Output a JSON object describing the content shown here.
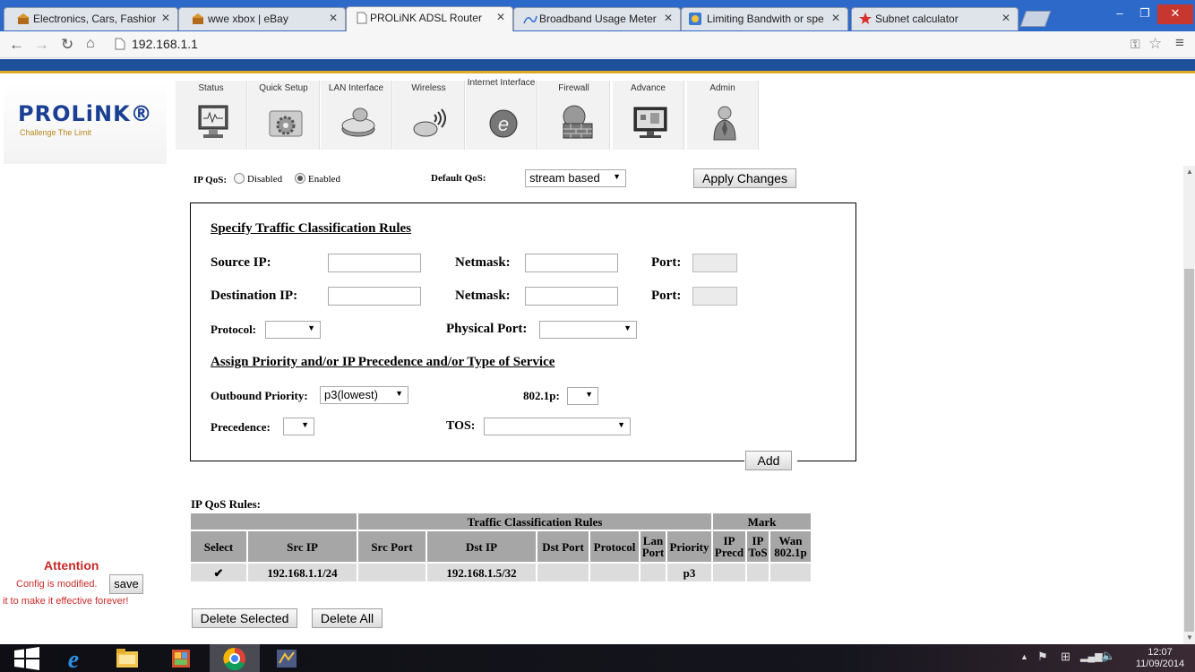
{
  "browser": {
    "tabs": [
      {
        "title": "Electronics, Cars, Fashion,",
        "active": false
      },
      {
        "title": "wwe xbox | eBay",
        "active": false
      },
      {
        "title": "PROLiNK ADSL Router",
        "active": true
      },
      {
        "title": "Broadband Usage Meter |",
        "active": false
      },
      {
        "title": "Limiting Bandwith or spe",
        "active": false
      },
      {
        "title": "Subnet calculator",
        "active": false
      }
    ],
    "url": "192.168.1.1",
    "window_buttons": {
      "minimize": "–",
      "restore": "❐",
      "close": "✕"
    }
  },
  "header": {
    "logo": "PROLiNK®",
    "tagline": "Challenge The Limit",
    "nav": [
      "Status",
      "Quick Setup",
      "LAN Interface",
      "Wireless",
      "Internet Interface",
      "Firewall",
      "Advance",
      "Admin"
    ]
  },
  "qos": {
    "label": "IP QoS:",
    "option_disabled": "Disabled",
    "option_enabled": "Enabled",
    "selected": "Enabled",
    "default_label": "Default QoS:",
    "default_value": "stream based",
    "apply_label": "Apply Changes"
  },
  "classification": {
    "heading": "Specify Traffic Classification Rules",
    "source_ip_label": "Source IP:",
    "destination_ip_label": "Destination IP:",
    "netmask_label": "Netmask:",
    "port_label": "Port:",
    "protocol_label": "Protocol:",
    "physical_port_label": "Physical Port:",
    "source_ip_value": "",
    "source_netmask_value": "",
    "destination_ip_value": "",
    "destination_netmask_value": "",
    "protocol_value": "",
    "physical_port_value": ""
  },
  "priority": {
    "heading": "Assign Priority and/or IP Precedence and/or Type of Service",
    "outbound_label": "Outbound Priority:",
    "outbound_value": "p3(lowest)",
    "dot1p_label": "802.1p:",
    "dot1p_value": "",
    "precedence_label": "Precedence:",
    "precedence_value": "",
    "tos_label": "TOS:",
    "tos_value": "",
    "add_label": "Add"
  },
  "rules": {
    "title": "IP QoS Rules:",
    "group_classification": "Traffic Classification Rules",
    "group_mark": "Mark",
    "columns": [
      "Select",
      "Src IP",
      "Src Port",
      "Dst IP",
      "Dst Port",
      "Protocol",
      "Lan Port",
      "Priority",
      "IP Precd",
      "IP ToS",
      "Wan 802.1p"
    ],
    "rows": [
      {
        "select": "✔",
        "src_ip": "192.168.1.1/24",
        "src_port": "",
        "dst_ip": "192.168.1.5/32",
        "dst_port": "",
        "protocol": "",
        "lan_port": "",
        "priority": "p3",
        "ip_precd": "",
        "ip_tos": "",
        "wan_8021p": ""
      }
    ],
    "delete_selected_label": "Delete Selected",
    "delete_all_label": "Delete All"
  },
  "attention": {
    "title": "Attention",
    "message": "Config is modified.",
    "save_label": "save",
    "footer": "it to make it effective forever!"
  },
  "taskbar": {
    "time": "12:07",
    "date": "11/09/2014"
  }
}
